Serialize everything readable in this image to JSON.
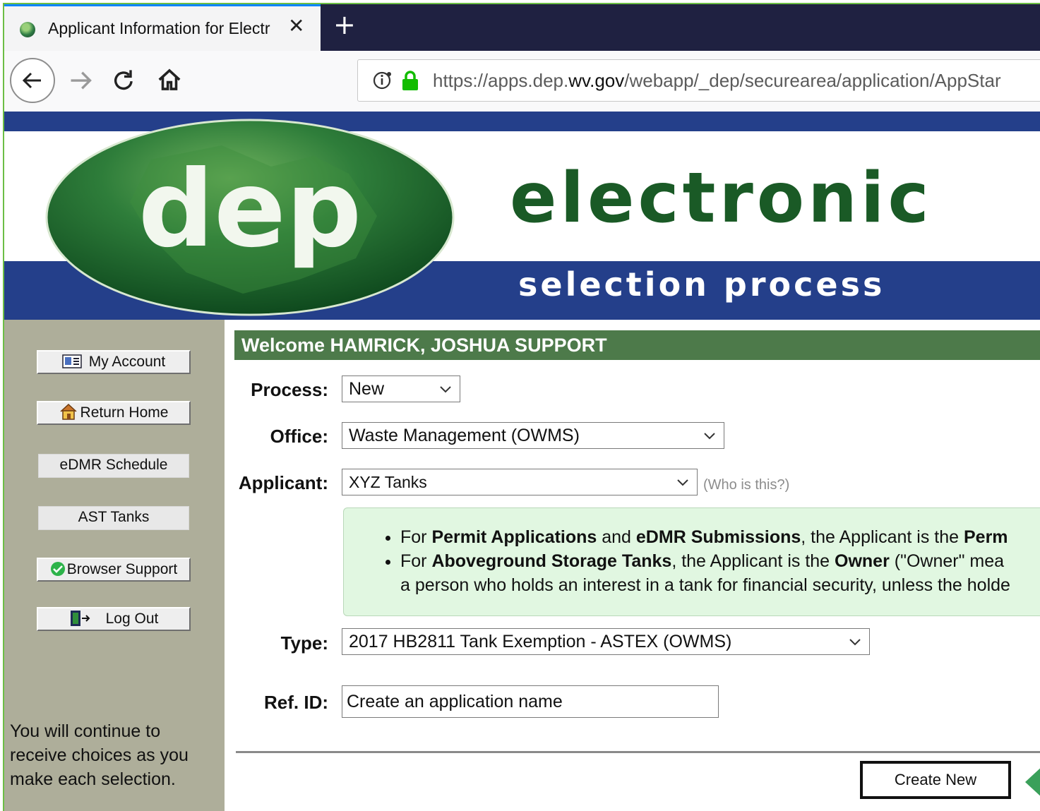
{
  "browser": {
    "tab_title": "Applicant Information for Electr",
    "tab_close": "✕",
    "new_tab": "+",
    "url_prefix": "https://apps.dep.",
    "url_domain": "wv.gov",
    "url_path": "/webapp/_dep/securearea/application/AppStar"
  },
  "banner": {
    "logo_text": "dep",
    "headline": "electronic",
    "subhead": "selection process",
    "colors": {
      "blue": "#243f8a",
      "green": "#1a5a26"
    }
  },
  "sidebar": {
    "buttons": [
      {
        "label": "My Account",
        "icon": "id-card-icon"
      },
      {
        "label": "Return Home",
        "icon": "house-icon"
      },
      {
        "label": "eDMR Schedule"
      },
      {
        "label": "AST Tanks"
      },
      {
        "label": "Browser Support",
        "icon": "green-check-icon"
      },
      {
        "label": "Log Out",
        "icon": "door-exit-icon"
      }
    ],
    "help_text": "You will continue to receive choices as you make each selection."
  },
  "main": {
    "welcome": "Welcome HAMRICK, JOSHUA SUPPORT",
    "process": {
      "label": "Process:",
      "value": "New"
    },
    "office": {
      "label": "Office:",
      "value": "Waste Management (OWMS)"
    },
    "applicant": {
      "label": "Applicant:",
      "value": "XYZ Tanks",
      "help_link": "(Who is this?)"
    },
    "info": {
      "line1_a": "For ",
      "line1_b": "Permit Applications",
      "line1_c": " and ",
      "line1_d": "eDMR Submissions",
      "line1_e": ", the Applicant is the ",
      "line1_f": "Perm",
      "line2_a": "For ",
      "line2_b": "Aboveground Storage Tanks",
      "line2_c": ", the Applicant is the ",
      "line2_d": "Owner",
      "line2_e": " (\"Owner\" mea",
      "line3": "a person who holds an interest in a tank for financial security, unless the holde"
    },
    "type": {
      "label": "Type:",
      "value": "2017 HB2811 Tank Exemption - ASTEX (OWMS)"
    },
    "refid": {
      "label": "Ref. ID:",
      "value": "Create an application name"
    },
    "create_button": "Create New"
  }
}
